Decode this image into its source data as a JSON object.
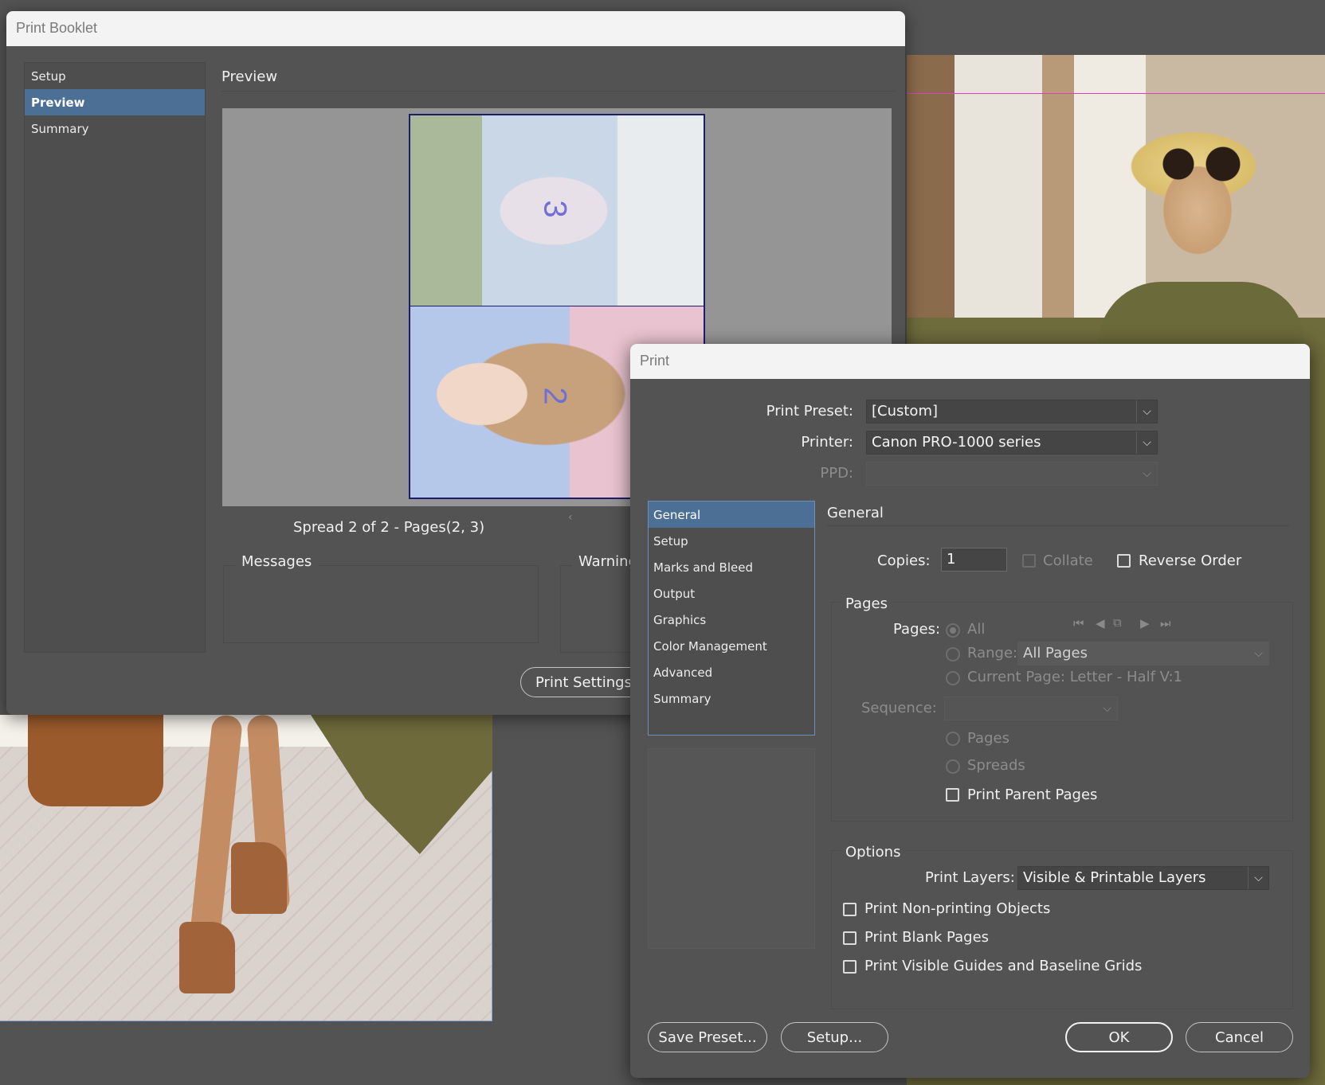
{
  "booklet": {
    "title": "Print Booklet",
    "nav": [
      {
        "label": "Setup"
      },
      {
        "label": "Preview"
      },
      {
        "label": "Summary"
      }
    ],
    "section_title": "Preview",
    "page_numbers": [
      "3",
      "2"
    ],
    "spread_label": "Spread 2 of 2 - Pages(2, 3)",
    "messages_label": "Messages",
    "warnings_label": "Warnings",
    "print_settings_button": "Print Settings..."
  },
  "print": {
    "title": "Print",
    "preset_label": "Print Preset:",
    "preset_value": "[Custom]",
    "printer_label": "Printer:",
    "printer_value": "Canon PRO-1000 series",
    "ppd_label": "PPD:",
    "ppd_value": "",
    "nav": [
      {
        "label": "General"
      },
      {
        "label": "Setup"
      },
      {
        "label": "Marks and Bleed"
      },
      {
        "label": "Output"
      },
      {
        "label": "Graphics"
      },
      {
        "label": "Color Management"
      },
      {
        "label": "Advanced"
      },
      {
        "label": "Summary"
      }
    ],
    "section_title": "General",
    "copies_label": "Copies:",
    "copies_value": "1",
    "collate_label": "Collate",
    "reverse_order_label": "Reverse Order",
    "pages_group": {
      "title": "Pages",
      "pages_label": "Pages:",
      "all_label": "All",
      "range_label": "Range:",
      "range_value": "All Pages",
      "current_page_label": "Current Page: Letter - Half V:1",
      "sequence_label": "Sequence:",
      "sequence_value": "",
      "pages_option": "Pages",
      "spreads_option": "Spreads",
      "print_parent_pages": "Print Parent Pages"
    },
    "options_group": {
      "title": "Options",
      "print_layers_label": "Print Layers:",
      "print_layers_value": "Visible & Printable Layers",
      "non_printing": "Print Non-printing Objects",
      "blank_pages": "Print Blank Pages",
      "guides": "Print Visible Guides and Baseline Grids"
    },
    "buttons": {
      "save_preset": "Save Preset...",
      "setup": "Setup...",
      "ok": "OK",
      "cancel": "Cancel"
    }
  }
}
